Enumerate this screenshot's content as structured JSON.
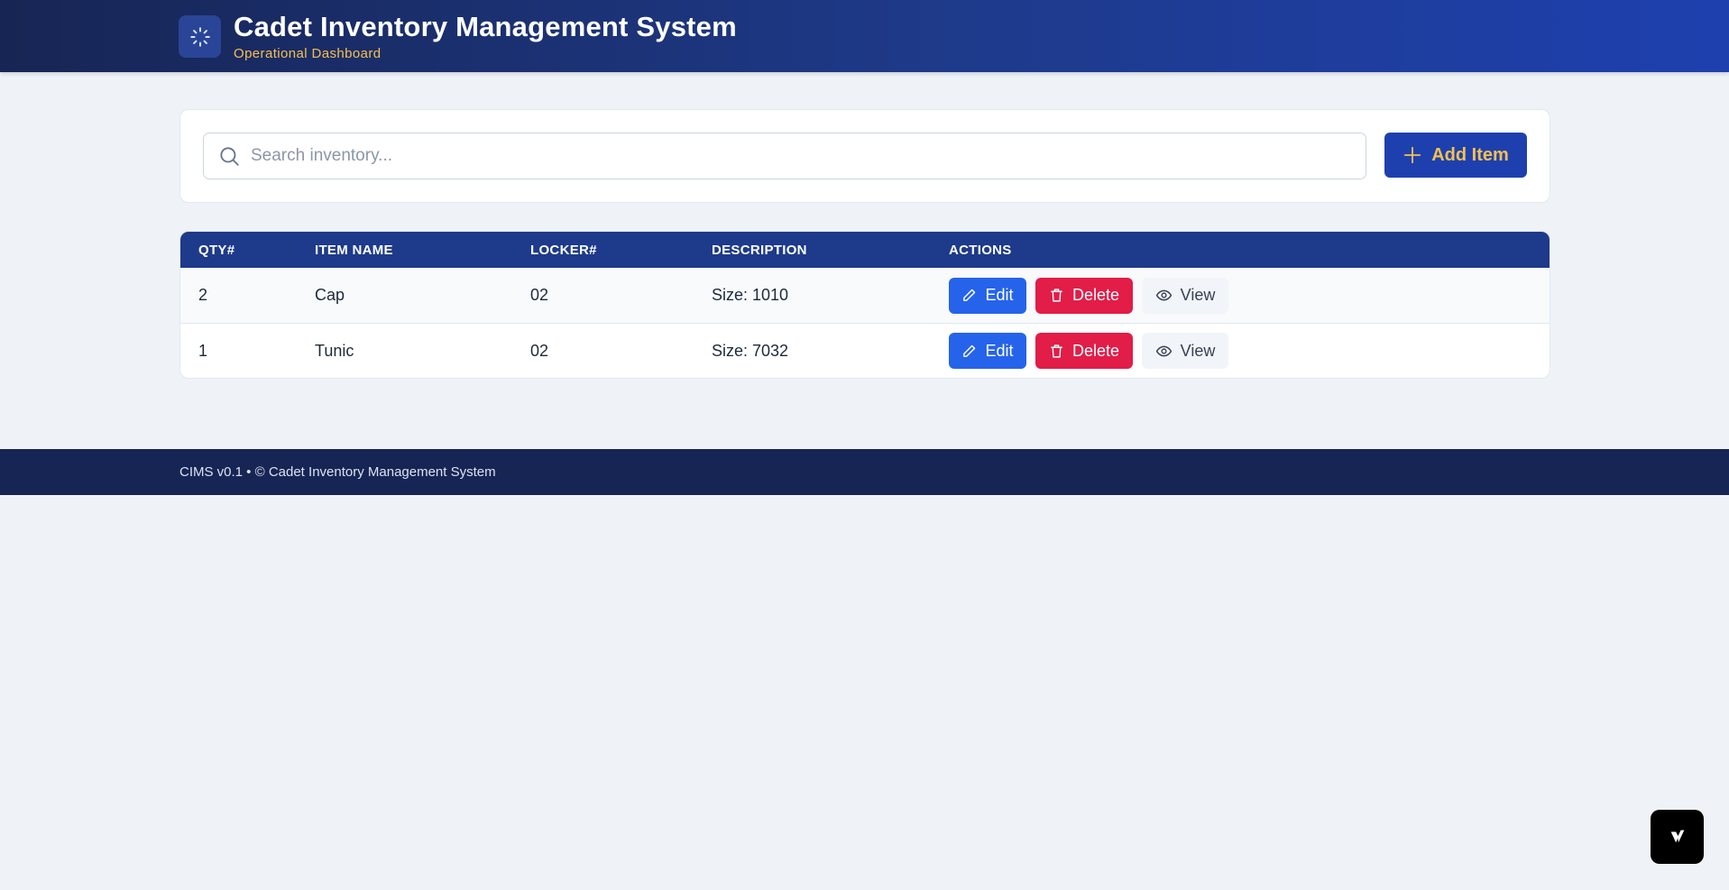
{
  "header": {
    "title": "Cadet Inventory Management System",
    "subtitle": "Operational Dashboard",
    "logo_icon": "loader-icon"
  },
  "toolbar": {
    "search_placeholder": "Search inventory...",
    "search_value": "",
    "add_label": "Add Item"
  },
  "table": {
    "columns": [
      "QTY#",
      "ITEM NAME",
      "LOCKER#",
      "DESCRIPTION",
      "ACTIONS"
    ],
    "rows": [
      {
        "qty": "2",
        "name": "Cap",
        "locker": "02",
        "description": "Size: 1010"
      },
      {
        "qty": "1",
        "name": "Tunic",
        "locker": "02",
        "description": "Size: 7032"
      }
    ],
    "actions": {
      "edit": "Edit",
      "delete": "Delete",
      "view": "View"
    }
  },
  "footer": {
    "text": "CIMS v0.1 • © Cadet Inventory Management System"
  },
  "colors": {
    "header": "#1e3a8a",
    "accent": "#f5c04f",
    "primary": "#1e40af",
    "edit": "#2563eb",
    "delete": "#e11d48",
    "footer": "#172554"
  }
}
